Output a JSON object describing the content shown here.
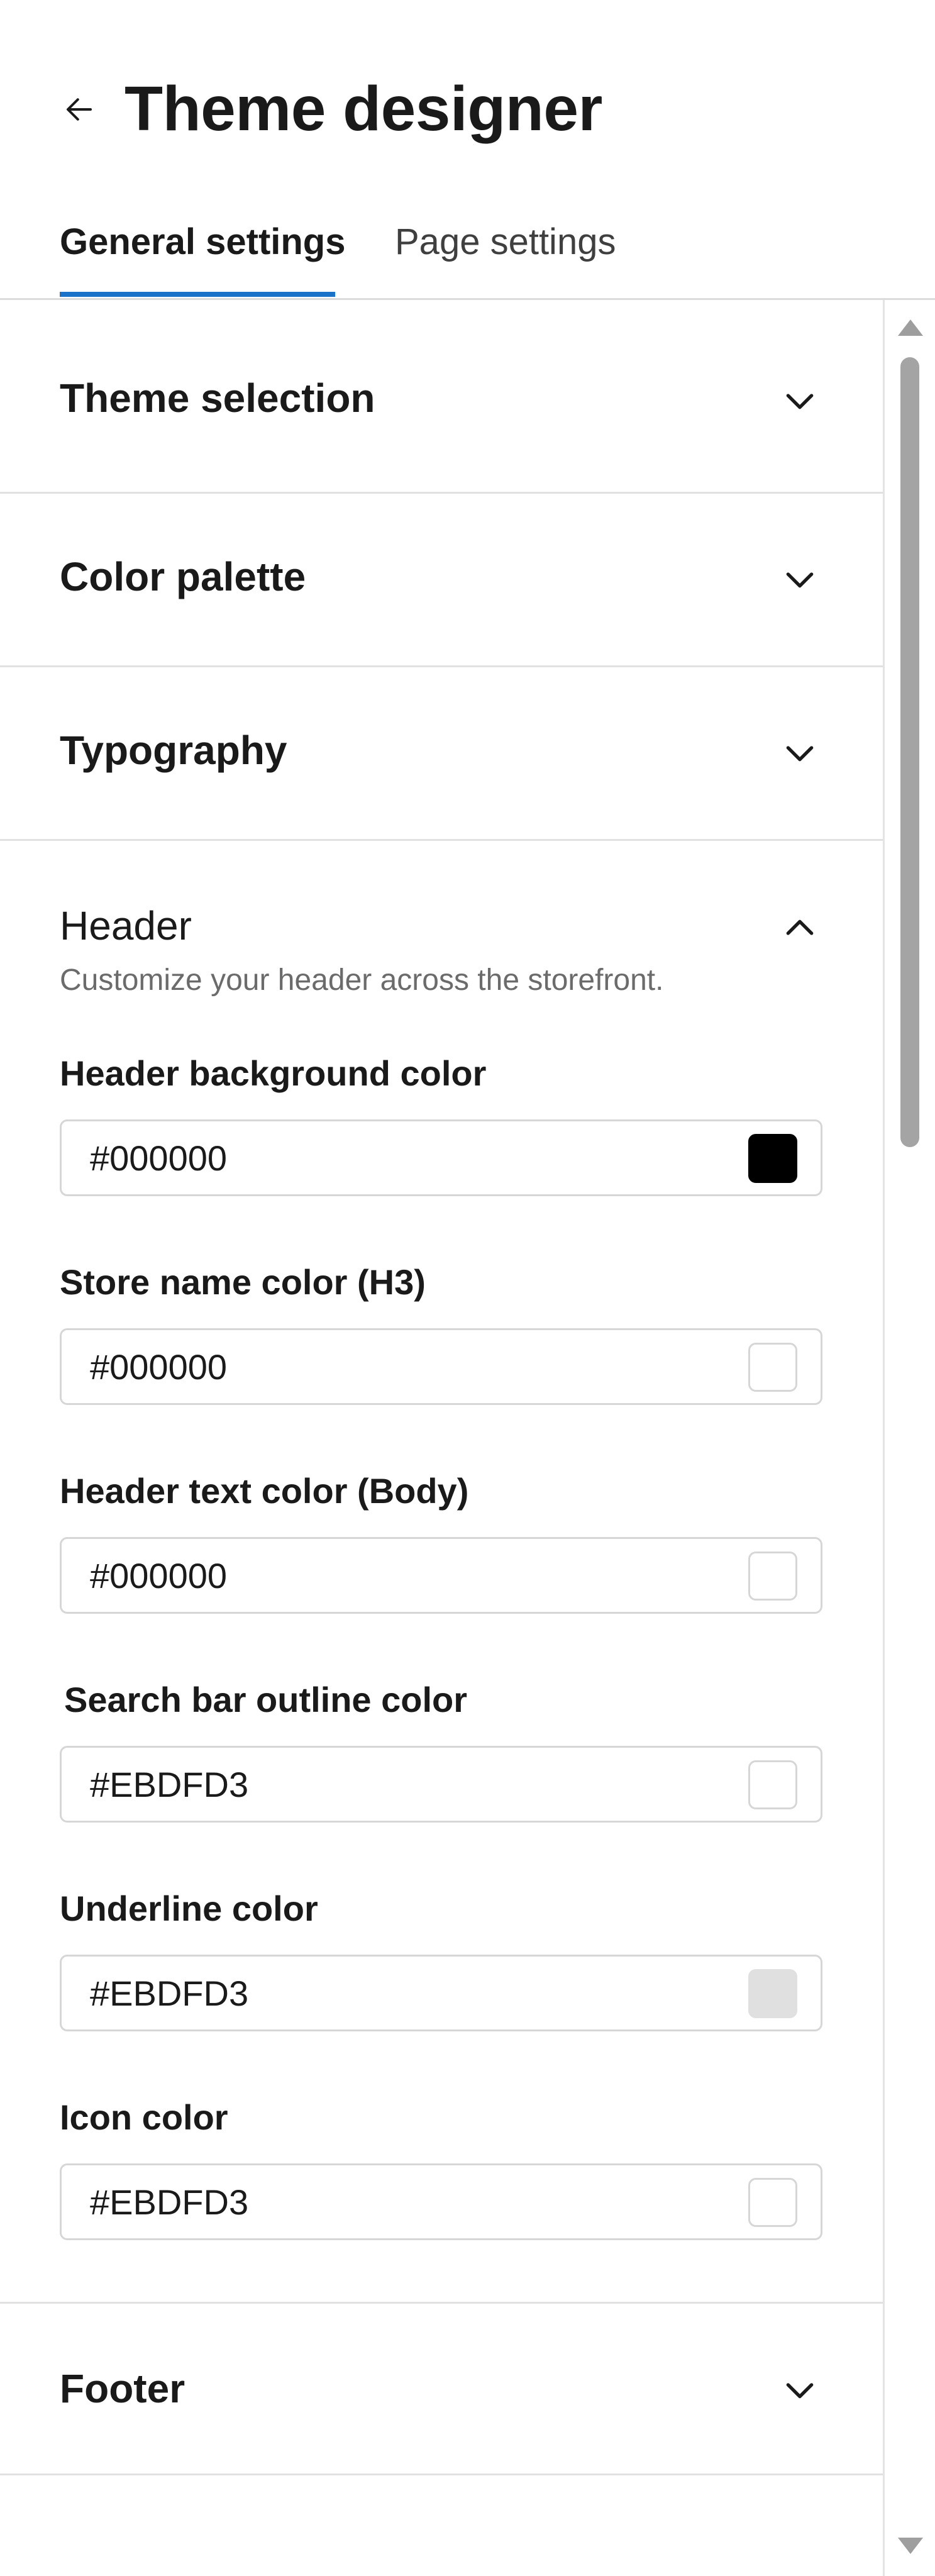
{
  "header": {
    "title": "Theme designer",
    "back_icon": "arrow-left-icon"
  },
  "tabs": [
    {
      "label": "General settings",
      "selected": true
    },
    {
      "label": "Page settings",
      "selected": false
    }
  ],
  "sections": {
    "theme_selection": {
      "title": "Theme selection",
      "expanded": false
    },
    "color_palette": {
      "title": "Color palette",
      "expanded": false
    },
    "typography": {
      "title": "Typography",
      "expanded": false
    },
    "header": {
      "title": "Header",
      "expanded": true,
      "description": "Customize your header across the storefront.",
      "fields": [
        {
          "label": "Header background color",
          "value": "#000000",
          "swatch": "#000000"
        },
        {
          "label": "Store name color (H3)",
          "value": "#000000",
          "swatch": "#ffffff"
        },
        {
          "label": "Header text color (Body)",
          "value": "#000000",
          "swatch": "#ffffff"
        },
        {
          "label": "Search bar outline color",
          "value": "#EBDFD3",
          "swatch": "#ffffff"
        },
        {
          "label": "Underline color",
          "value": "#EBDFD3",
          "swatch": "#e0e0e0"
        },
        {
          "label": "Icon color",
          "value": "#EBDFD3",
          "swatch": "#ffffff"
        }
      ]
    },
    "footer": {
      "title": "Footer",
      "expanded": false
    }
  },
  "colors": {
    "accent": "#1a73c8",
    "text": "#1a1a1a",
    "muted_text": "#6b6b6b",
    "border": "#d6d6d6"
  }
}
